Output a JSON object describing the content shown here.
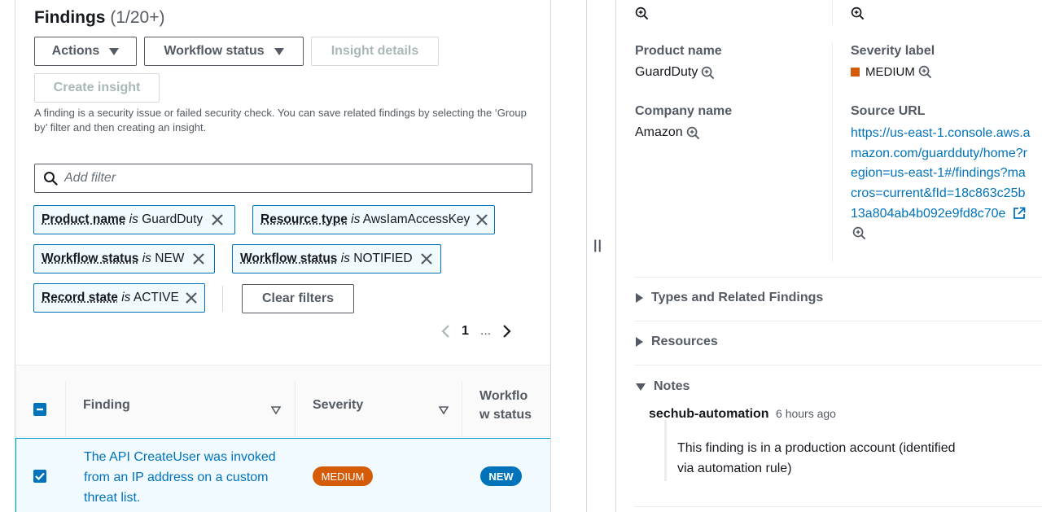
{
  "findings": {
    "title": "Findings",
    "count": "(1/20+)",
    "buttons": {
      "actions": "Actions",
      "workflow_status": "Workflow status",
      "insight_details": "Insight details",
      "create_insight": "Create insight"
    },
    "description": "A finding is a security issue or failed security check. You can save related findings by selecting the ‘Group by’ filter and then creating an insight.",
    "filter_placeholder": "Add filter",
    "filters": [
      {
        "key": "Product name",
        "op": "is",
        "value": "GuardDuty"
      },
      {
        "key": "Resource type",
        "op": "is",
        "value": "AwsIamAccessKey"
      },
      {
        "key": "Workflow status",
        "op": "is",
        "value": "NEW"
      },
      {
        "key": "Workflow status",
        "op": "is",
        "value": "NOTIFIED"
      },
      {
        "key": "Record state",
        "op": "is",
        "value": "ACTIVE"
      }
    ],
    "clear_filters": "Clear filters",
    "pagination": {
      "current": "1",
      "ellipsis": "..."
    },
    "table": {
      "headers": {
        "finding": "Finding",
        "severity": "Severity",
        "workflow_line1": "Workflo",
        "workflow_line2": "w status"
      },
      "rows": [
        {
          "finding": "The API CreateUser was invoked from an IP address on a custom threat list.",
          "severity": "MEDIUM",
          "workflow": "NEW",
          "selected": true
        }
      ]
    }
  },
  "split_handle": "||",
  "detail": {
    "product_name_label": "Product name",
    "product_name_value": "GuardDuty",
    "severity_label_label": "Severity label",
    "severity_label_value": "MEDIUM",
    "company_name_label": "Company name",
    "company_name_value": "Amazon",
    "source_url_label": "Source URL",
    "source_url_value": "https://us-east-1.console.aws.amazon.com/guardduty/home?region=us-east-1#/findings?macros=current&fId=18c863c25b13a804ab4b092e9fd8c70e",
    "sections": {
      "types": "Types and Related Findings",
      "resources": "Resources",
      "notes": "Notes"
    },
    "note": {
      "author": "sechub-automation",
      "time": "6 hours ago",
      "body": "This finding is in a production account (identified via automation rule)"
    },
    "colors": {
      "severity_medium": "#d45b07",
      "link": "#0073bb",
      "new_badge": "#0073bb"
    }
  }
}
